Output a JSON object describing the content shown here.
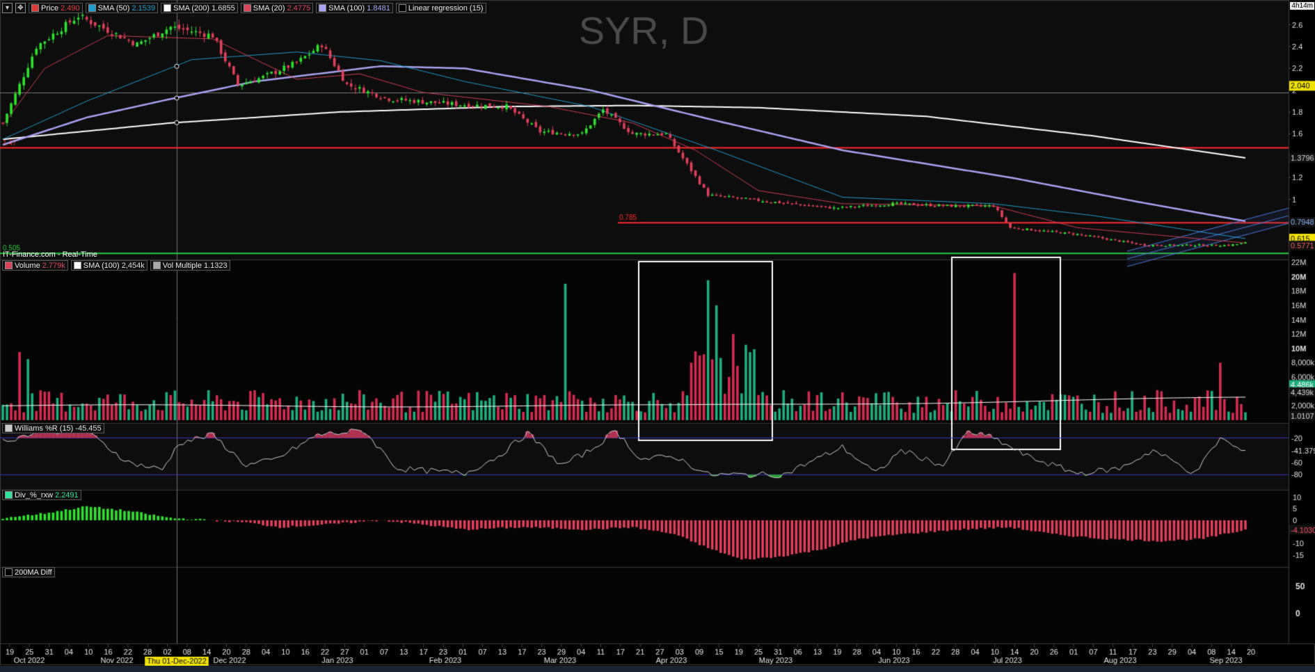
{
  "symbol_title": "SYR, D",
  "source_label": "IT-Finance.com - Real-Time",
  "time_badge": "4h14m",
  "price_legend": [
    {
      "label": "Price",
      "value": "2.490",
      "color": "#e03b3b"
    },
    {
      "label": "SMA (50)",
      "value": "2.1539",
      "color": "#1f9ccf"
    },
    {
      "label": "SMA (200)",
      "value": "1.6855",
      "color": "#ffffff"
    },
    {
      "label": "SMA (20)",
      "value": "2.4775",
      "color": "#d9435a"
    },
    {
      "label": "SMA (100)",
      "value": "1.8481",
      "color": "#a9a3f2"
    },
    {
      "label": "Linear regression (15)",
      "value": "",
      "color": "#000000"
    }
  ],
  "volume_legend": [
    {
      "label": "Volume",
      "value": "2.779k",
      "color": "#d9435a"
    },
    {
      "label": "SMA (100)",
      "value": "2,454k",
      "color": "#ffffff"
    },
    {
      "label": "Vol Multiple",
      "value": "1.1323",
      "color": "#aaaaaa"
    }
  ],
  "williams_legend": [
    {
      "label": "Williams %R (15)",
      "value": "-45.455",
      "color": "#cccccc"
    }
  ],
  "div_legend": [
    {
      "label": "Div_%_rxw",
      "value": "2.2491",
      "color": "#2ee39a"
    }
  ],
  "ma200_legend": [
    {
      "label": "200MA Diff",
      "value": "",
      "color": "#000000"
    }
  ],
  "crosshair_date": "Thu 01-Dec-2022",
  "colors": {
    "up": "#2ee32e",
    "down": "#e0405a",
    "vol_up": "#1fae7e",
    "vol_down": "#d32c50",
    "sma50": "#1f9ccf",
    "sma200": "#ffffff",
    "sma20": "#cf3d55",
    "sma100": "#a9a3f2",
    "support": "#ff2a2a",
    "green_line": "#2ecc40",
    "channel": "#4f7bd6",
    "band": "#3a36c8",
    "grid": "#1e1e1e",
    "background": "#000000",
    "panel": "#0f0f0f"
  },
  "chart_data": [
    {
      "type": "candlestick",
      "title": "SYR, D",
      "x_tick_labels": [
        "19",
        "25",
        "31",
        "04",
        "10",
        "16",
        "22",
        "28",
        "02",
        "08",
        "14",
        "20",
        "28",
        "04",
        "10",
        "16",
        "22",
        "27",
        "01",
        "07",
        "13",
        "17",
        "23",
        "01",
        "07",
        "13",
        "17",
        "23",
        "29",
        "04",
        "11",
        "17",
        "21",
        "27",
        "03",
        "09",
        "15",
        "19",
        "25",
        "31",
        "06",
        "13",
        "19",
        "28",
        "04",
        "10",
        "16",
        "22",
        "28",
        "04",
        "10",
        "14",
        "20",
        "26",
        "01",
        "07",
        "11",
        "17",
        "23",
        "29",
        "04",
        "08",
        "14",
        "20"
      ],
      "months": [
        "Oct 2022",
        "Nov 2022",
        "Dec 2022",
        "Jan 2023",
        "Feb 2023",
        "Mar 2023",
        "Apr 2023",
        "May 2023",
        "Jun 2023",
        "Jul 2023",
        "Aug 2023",
        "Sep 2023"
      ],
      "y_ticks": [
        2.6,
        2.4,
        2.2,
        2.0,
        1.8,
        1.6,
        1.4,
        1.2,
        1.0,
        0.8,
        0.6
      ],
      "ylim": [
        0.5,
        2.75
      ],
      "price_key_points": [
        [
          0,
          1.7
        ],
        [
          8,
          2.4
        ],
        [
          18,
          2.68
        ],
        [
          32,
          2.42
        ],
        [
          40,
          2.58
        ],
        [
          50,
          2.5
        ],
        [
          56,
          2.05
        ],
        [
          62,
          2.12
        ],
        [
          70,
          2.25
        ],
        [
          76,
          2.42
        ],
        [
          82,
          2.05
        ],
        [
          92,
          1.92
        ],
        [
          108,
          1.87
        ],
        [
          120,
          1.85
        ],
        [
          128,
          1.62
        ],
        [
          138,
          1.6
        ],
        [
          143,
          1.82
        ],
        [
          150,
          1.6
        ],
        [
          158,
          1.6
        ],
        [
          168,
          1.04
        ],
        [
          180,
          0.99
        ],
        [
          198,
          0.92
        ],
        [
          212,
          0.96
        ],
        [
          226,
          0.94
        ],
        [
          236,
          0.94
        ],
        [
          240,
          0.74
        ],
        [
          256,
          0.68
        ],
        [
          272,
          0.58
        ],
        [
          292,
          0.58
        ],
        [
          296,
          0.6
        ]
      ],
      "sma20_key_points": [
        [
          0,
          1.68
        ],
        [
          10,
          2.2
        ],
        [
          25,
          2.5
        ],
        [
          50,
          2.47
        ],
        [
          70,
          2.1
        ],
        [
          85,
          2.15
        ],
        [
          100,
          1.98
        ],
        [
          130,
          1.85
        ],
        [
          150,
          1.7
        ],
        [
          165,
          1.45
        ],
        [
          180,
          1.08
        ],
        [
          200,
          0.96
        ],
        [
          236,
          0.94
        ],
        [
          256,
          0.74
        ],
        [
          296,
          0.6
        ]
      ],
      "sma50_key_points": [
        [
          0,
          1.55
        ],
        [
          20,
          1.9
        ],
        [
          45,
          2.28
        ],
        [
          70,
          2.35
        ],
        [
          90,
          2.27
        ],
        [
          110,
          2.08
        ],
        [
          140,
          1.85
        ],
        [
          170,
          1.45
        ],
        [
          200,
          1.02
        ],
        [
          236,
          0.96
        ],
        [
          260,
          0.85
        ],
        [
          296,
          0.64
        ]
      ],
      "sma100_key_points": [
        [
          0,
          1.5
        ],
        [
          20,
          1.75
        ],
        [
          40,
          1.92
        ],
        [
          60,
          2.08
        ],
        [
          90,
          2.22
        ],
        [
          110,
          2.2
        ],
        [
          140,
          2.0
        ],
        [
          170,
          1.72
        ],
        [
          200,
          1.45
        ],
        [
          240,
          1.2
        ],
        [
          270,
          0.98
        ],
        [
          296,
          0.8
        ]
      ],
      "sma200_key_points": [
        [
          0,
          1.55
        ],
        [
          40,
          1.7
        ],
        [
          80,
          1.8
        ],
        [
          120,
          1.85
        ],
        [
          150,
          1.86
        ],
        [
          180,
          1.84
        ],
        [
          220,
          1.76
        ],
        [
          260,
          1.58
        ],
        [
          296,
          1.38
        ]
      ],
      "support_levels": [
        {
          "value": 1.4717,
          "label": "1.47"
        },
        {
          "value": 0.785,
          "label": "0.785"
        },
        {
          "value": 0.505,
          "label": "0.505"
        }
      ],
      "price_scale_markers": [
        "2.040",
        "1.3796",
        "0.7948",
        "0.615",
        "0.5771"
      ]
    },
    {
      "type": "bar",
      "title": "Volume",
      "y_tick_labels": [
        "22M",
        "20M",
        "18M",
        "16M",
        "14M",
        "12M",
        "10M",
        "8,000k",
        "6,000k",
        "4,000k",
        "2,000k"
      ],
      "ylim": [
        0,
        22000000
      ],
      "markers": [
        "4,486k",
        "4,439k",
        "1.0107"
      ],
      "spikes": [
        [
          4,
          9.5
        ],
        [
          6,
          8.5
        ],
        [
          134,
          19.0
        ],
        [
          168,
          19.5
        ],
        [
          170,
          16.0
        ],
        [
          174,
          12.0
        ],
        [
          177,
          10.5
        ],
        [
          241,
          20.5
        ],
        [
          290,
          8.0
        ]
      ],
      "sma100_level": 2454000
    },
    {
      "type": "line",
      "title": "Williams %R (15)",
      "y_tick_labels": [
        "-20",
        "-41.379",
        "-60",
        "-80"
      ],
      "ylim": [
        -100,
        0
      ],
      "levels": [
        -20,
        -80
      ],
      "key_points": [
        [
          0,
          -25
        ],
        [
          10,
          -8
        ],
        [
          20,
          -10
        ],
        [
          30,
          -60
        ],
        [
          38,
          -72
        ],
        [
          42,
          -28
        ],
        [
          50,
          -15
        ],
        [
          58,
          -65
        ],
        [
          65,
          -55
        ],
        [
          75,
          -15
        ],
        [
          86,
          -8
        ],
        [
          94,
          -70
        ],
        [
          110,
          -78
        ],
        [
          118,
          -50
        ],
        [
          125,
          -12
        ],
        [
          133,
          -65
        ],
        [
          140,
          -40
        ],
        [
          146,
          -8
        ],
        [
          152,
          -55
        ],
        [
          160,
          -50
        ],
        [
          168,
          -80
        ],
        [
          186,
          -80
        ],
        [
          192,
          -60
        ],
        [
          200,
          -35
        ],
        [
          208,
          -78
        ],
        [
          214,
          -40
        ],
        [
          224,
          -65
        ],
        [
          230,
          -10
        ],
        [
          236,
          -20
        ],
        [
          244,
          -50
        ],
        [
          256,
          -78
        ],
        [
          266,
          -70
        ],
        [
          274,
          -40
        ],
        [
          284,
          -78
        ],
        [
          290,
          -20
        ],
        [
          296,
          -45
        ]
      ]
    },
    {
      "type": "bar",
      "title": "Div_%_rxw",
      "y_tick_labels": [
        "10",
        "5",
        "0",
        "-4.1030",
        "-10",
        "-15"
      ],
      "ylim": [
        -19,
        12
      ],
      "key_points": [
        [
          0,
          1
        ],
        [
          10,
          3
        ],
        [
          20,
          6
        ],
        [
          30,
          4
        ],
        [
          40,
          1
        ],
        [
          50,
          0
        ],
        [
          58,
          -1
        ],
        [
          66,
          -3
        ],
        [
          76,
          -2
        ],
        [
          90,
          0
        ],
        [
          96,
          -1
        ],
        [
          110,
          -4
        ],
        [
          124,
          -3
        ],
        [
          140,
          -4
        ],
        [
          150,
          -3
        ],
        [
          160,
          -6
        ],
        [
          168,
          -12
        ],
        [
          176,
          -17
        ],
        [
          184,
          -16
        ],
        [
          194,
          -13
        ],
        [
          204,
          -8
        ],
        [
          214,
          -6
        ],
        [
          228,
          -4
        ],
        [
          240,
          -3
        ],
        [
          250,
          -6
        ],
        [
          262,
          -8
        ],
        [
          276,
          -9
        ],
        [
          286,
          -8
        ],
        [
          296,
          -4.1
        ]
      ]
    },
    {
      "type": "line",
      "title": "200MA Diff",
      "y_tick_labels": [
        "50",
        "0"
      ],
      "ylim": [
        -50,
        80
      ]
    }
  ]
}
